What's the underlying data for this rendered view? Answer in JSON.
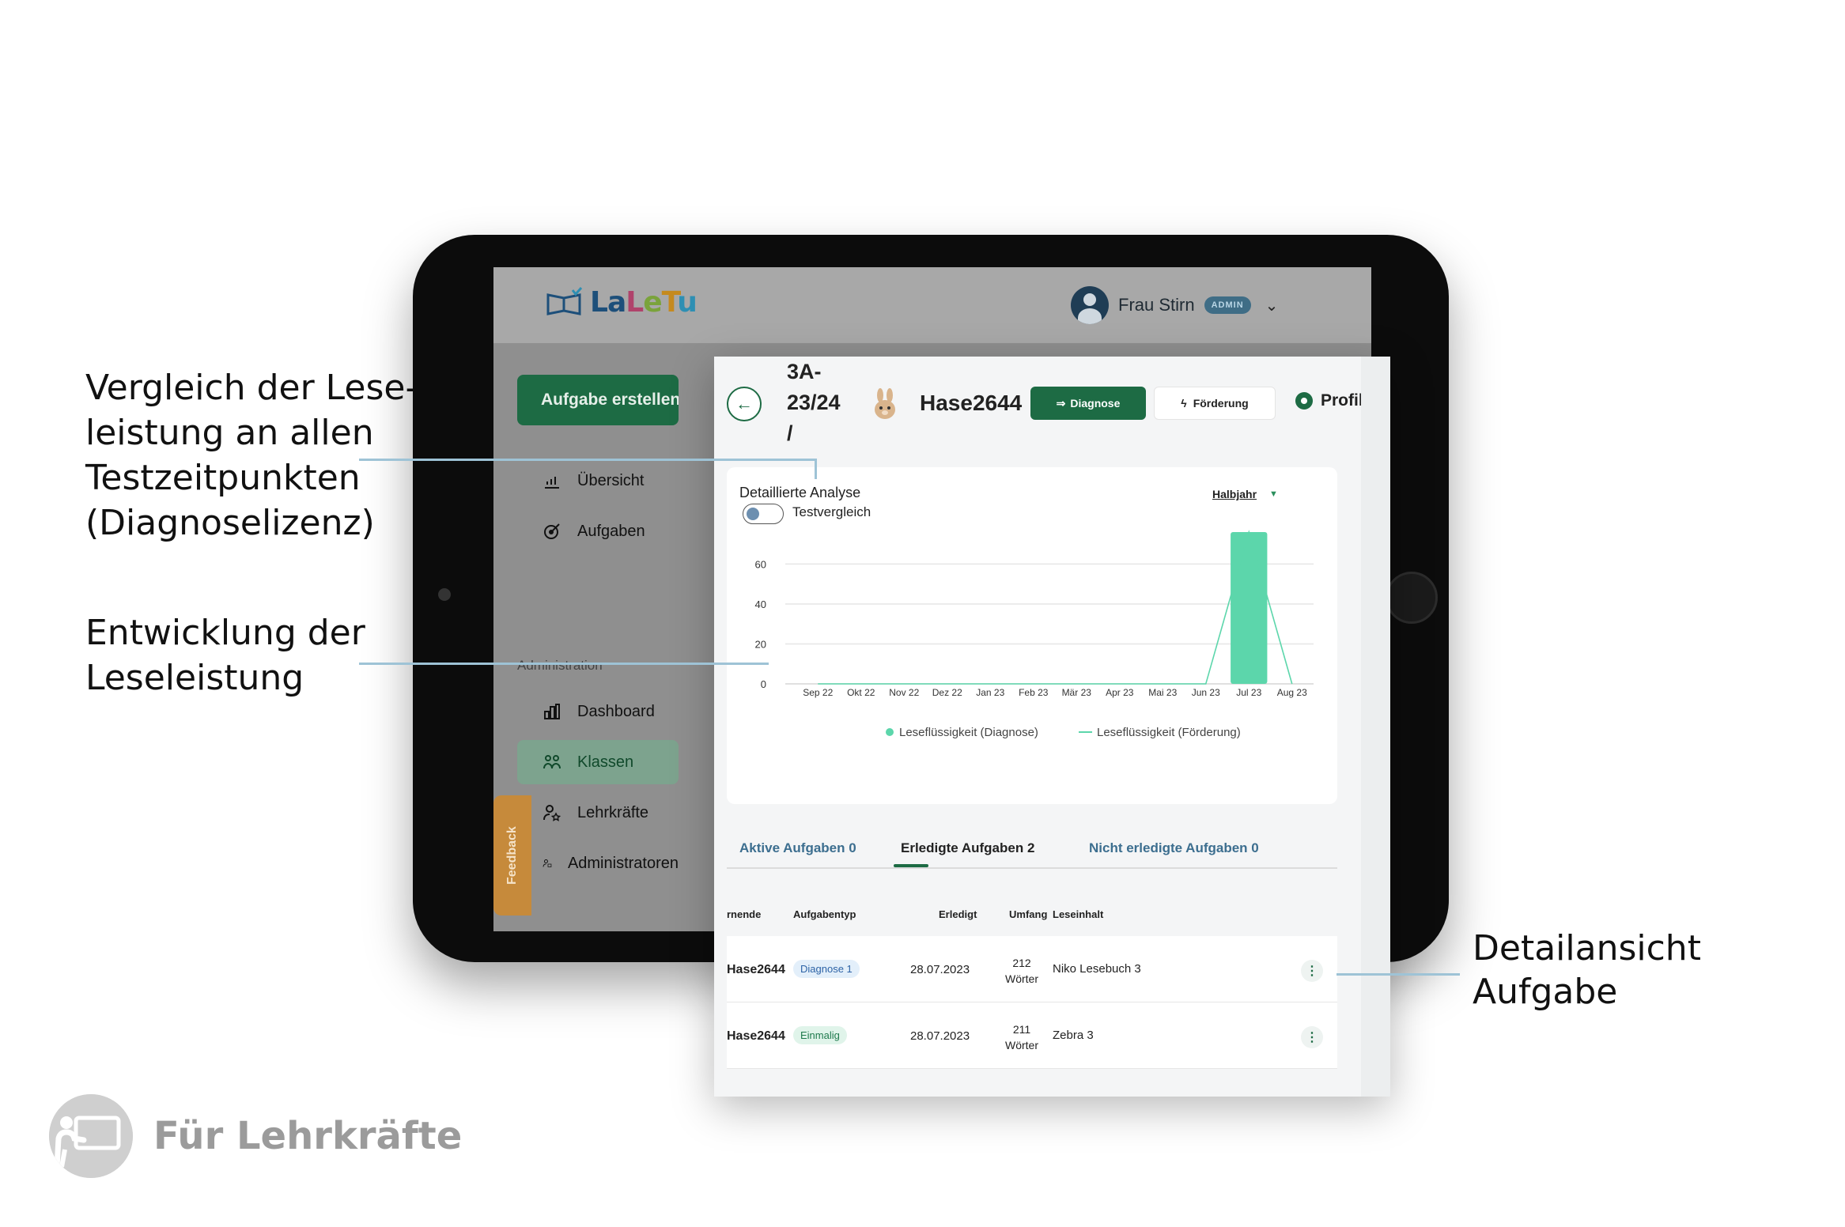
{
  "annotations": {
    "compare_lines": [
      "Vergleich der Lese-",
      "leistung an allen",
      "Testzeitpunkten",
      "(Diagnoselizenz)"
    ],
    "development_lines": [
      "Entwicklung der",
      "Leseleistung"
    ],
    "detail_lines": [
      "Detailansicht",
      "Aufgabe"
    ]
  },
  "footer": {
    "label": "Für Lehrkräfte"
  },
  "app": {
    "logo_parts": [
      "La",
      "L",
      "e",
      "T",
      "u"
    ],
    "user_name": "Frau Stirn",
    "user_role_badge": "ADMIN",
    "create_task_label": "Aufgabe erstellen",
    "nav": {
      "overview": "Übersicht",
      "tasks": "Aufgaben",
      "admin_section": "Administration",
      "dashboard": "Dashboard",
      "classes": "Klassen",
      "teachers": "Lehrkräfte",
      "administrators": "Administratoren"
    },
    "feedback_label": "Feedback"
  },
  "panel": {
    "class_name_lines": [
      "3A-",
      "23/24",
      "/"
    ],
    "student_name": "Hase2644",
    "diagnose_label": "Diagnose",
    "foerderung_label": "Förderung",
    "profil_label": "Profil",
    "chart_card": {
      "title": "Detaillierte Analyse",
      "toggle_label": "Testvergleich",
      "period": "Halbjahr"
    },
    "tabs": {
      "active": "Aktive Aufgaben 0",
      "done": "Erledigte Aufgaben 2",
      "undone": "Nicht erledigte Aufgaben 0"
    },
    "table": {
      "headers": [
        "rnende",
        "Aufgabentyp",
        "Erledigt",
        "Umfang",
        "Leseinhalt"
      ],
      "rows": [
        {
          "name": "Hase2644",
          "type": "Diagnose 1",
          "type_style": "blue",
          "date": "28.07.2023",
          "words_count": "212",
          "words_unit": "Wörter",
          "text": "Niko Lesebuch 3"
        },
        {
          "name": "Hase2644",
          "type": "Einmalig",
          "type_style": "green",
          "date": "28.07.2023",
          "words_count": "211",
          "words_unit": "Wörter",
          "text": "Zebra 3"
        }
      ],
      "menu_glyph": "⋮"
    }
  },
  "chart_data": {
    "type": "bar",
    "categories": [
      "Sep 22",
      "Okt 22",
      "Nov 22",
      "Dez 22",
      "Jan 23",
      "Feb 23",
      "Mär 23",
      "Apr 23",
      "Mai 23",
      "Jun 23",
      "Jul 23",
      "Aug 23"
    ],
    "series": [
      {
        "name": "Leseflüssigkeit (Diagnose)",
        "kind": "bar",
        "color": "#5cd6ab",
        "values": [
          0,
          0,
          0,
          0,
          0,
          0,
          0,
          0,
          0,
          0,
          76,
          0
        ]
      },
      {
        "name": "Leseflüssigkeit (Förderung)",
        "kind": "line",
        "color": "#5cd6ab",
        "values": [
          0,
          0,
          0,
          0,
          0,
          0,
          0,
          0,
          0,
          0,
          76,
          0
        ]
      }
    ],
    "yticks": [
      0,
      20,
      40,
      60
    ],
    "ylim": [
      0,
      76
    ],
    "grid": true,
    "legend": "bottom",
    "title": "Detaillierte Analyse",
    "xlabel": "",
    "ylabel": ""
  },
  "colors": {
    "brand_green": "#1d6b44",
    "chart_green": "#5cd6ab",
    "leader_line": "#9ec3d6"
  }
}
